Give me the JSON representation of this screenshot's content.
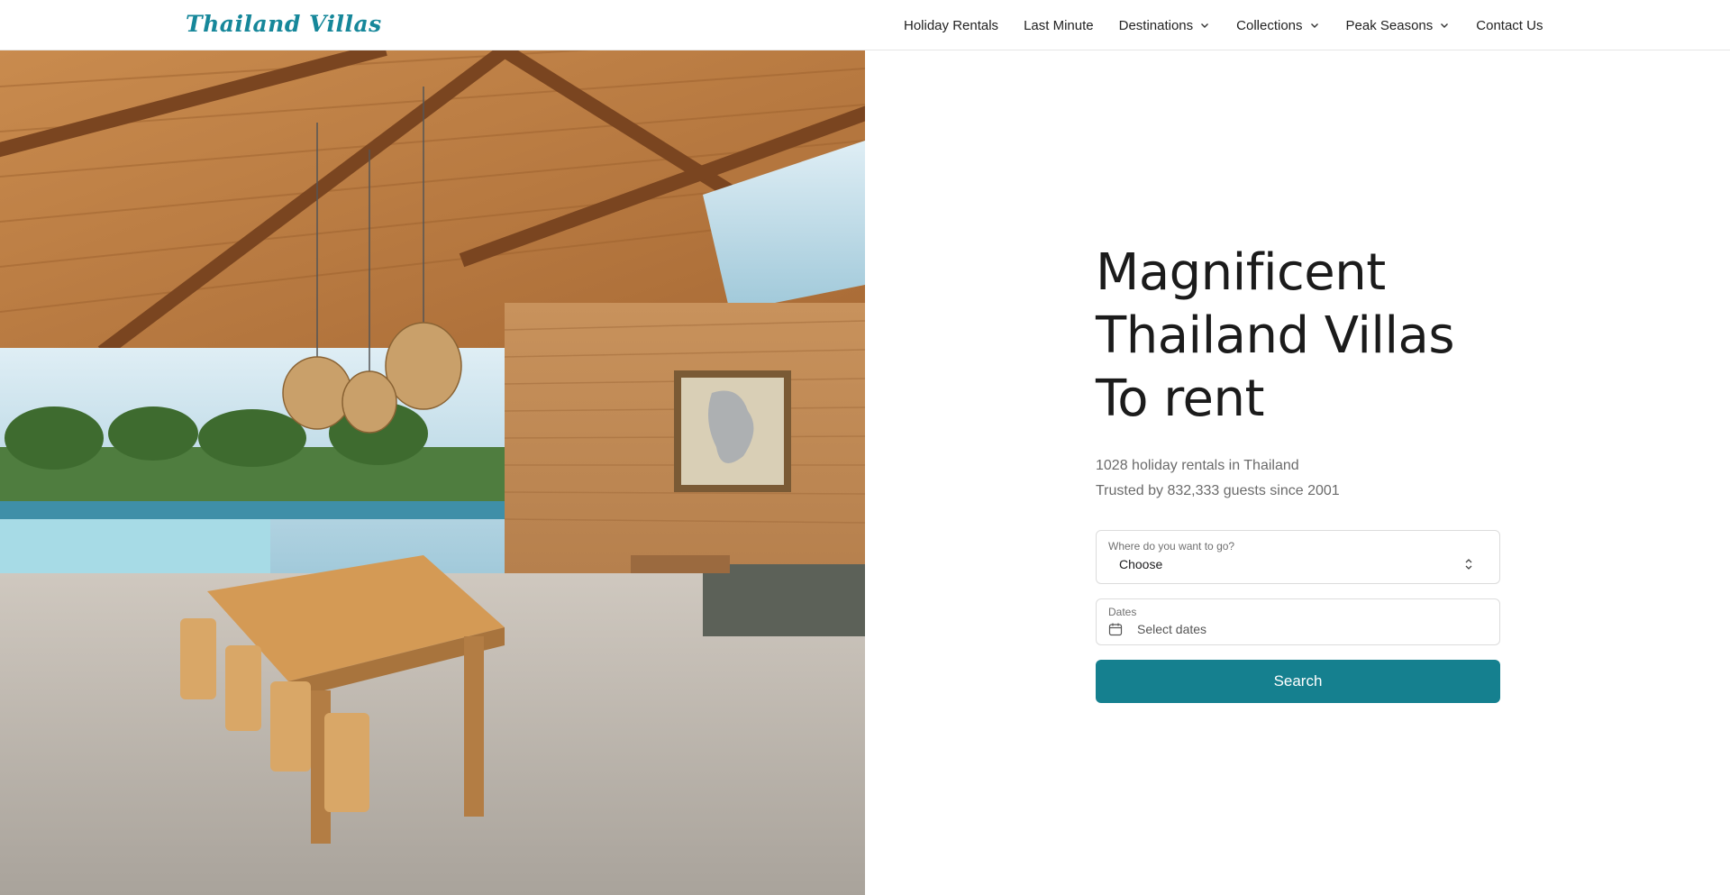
{
  "header": {
    "logo": "Thailand Villas",
    "nav": [
      {
        "label": "Holiday Rentals",
        "has_dropdown": false
      },
      {
        "label": "Last Minute",
        "has_dropdown": false
      },
      {
        "label": "Destinations",
        "has_dropdown": true
      },
      {
        "label": "Collections",
        "has_dropdown": true
      },
      {
        "label": "Peak Seasons",
        "has_dropdown": true
      },
      {
        "label": "Contact Us",
        "has_dropdown": false
      }
    ]
  },
  "hero": {
    "title_lines": [
      "Magnificent",
      "Thailand Villas",
      "To rent"
    ],
    "stats": [
      "1028 holiday rentals in Thailand",
      "Trusted by 832,333 guests since 2001"
    ]
  },
  "search": {
    "destination_label": "Where do you want to go?",
    "destination_value": "Choose",
    "dates_label": "Dates",
    "dates_placeholder": "Select dates",
    "button_label": "Search"
  },
  "colors": {
    "brand": "#16879a",
    "button": "#15808f",
    "text": "#1b1b1b",
    "muted": "#6b6b6b"
  },
  "icons": [
    "chevron-down-icon",
    "calendar-icon",
    "sort-arrows-icon"
  ]
}
